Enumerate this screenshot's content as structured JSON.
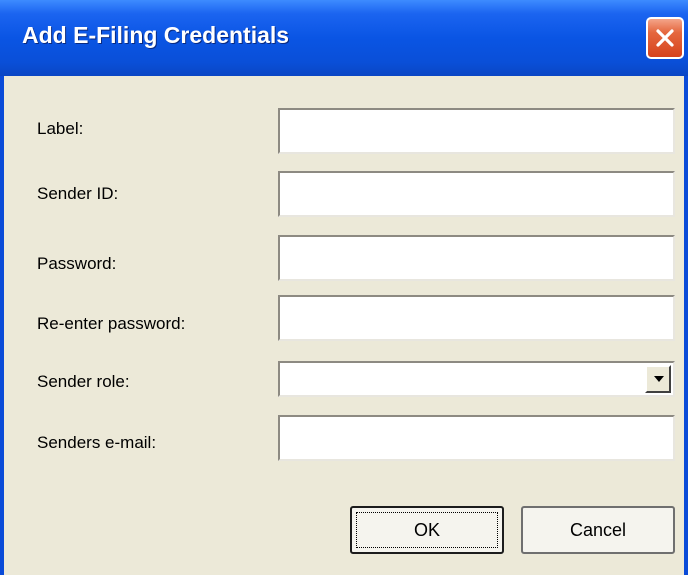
{
  "window": {
    "title": "Add E-Filing Credentials"
  },
  "form": {
    "label_label": "Label:",
    "label_value": "",
    "sender_id_label": "Sender ID:",
    "sender_id_value": "",
    "password_label": "Password:",
    "password_value": "",
    "reenter_password_label": "Re-enter password:",
    "reenter_password_value": "",
    "sender_role_label": "Sender role:",
    "sender_role_value": "",
    "senders_email_label": "Senders e-mail:",
    "senders_email_value": ""
  },
  "buttons": {
    "ok_label": "OK",
    "cancel_label": "Cancel"
  },
  "icons": {
    "close": "close-icon",
    "dropdown": "chevron-down-icon"
  },
  "colors": {
    "titlebar": "#0a55e4",
    "close_button": "#d6431d",
    "dialog_background": "#ece9d8"
  }
}
